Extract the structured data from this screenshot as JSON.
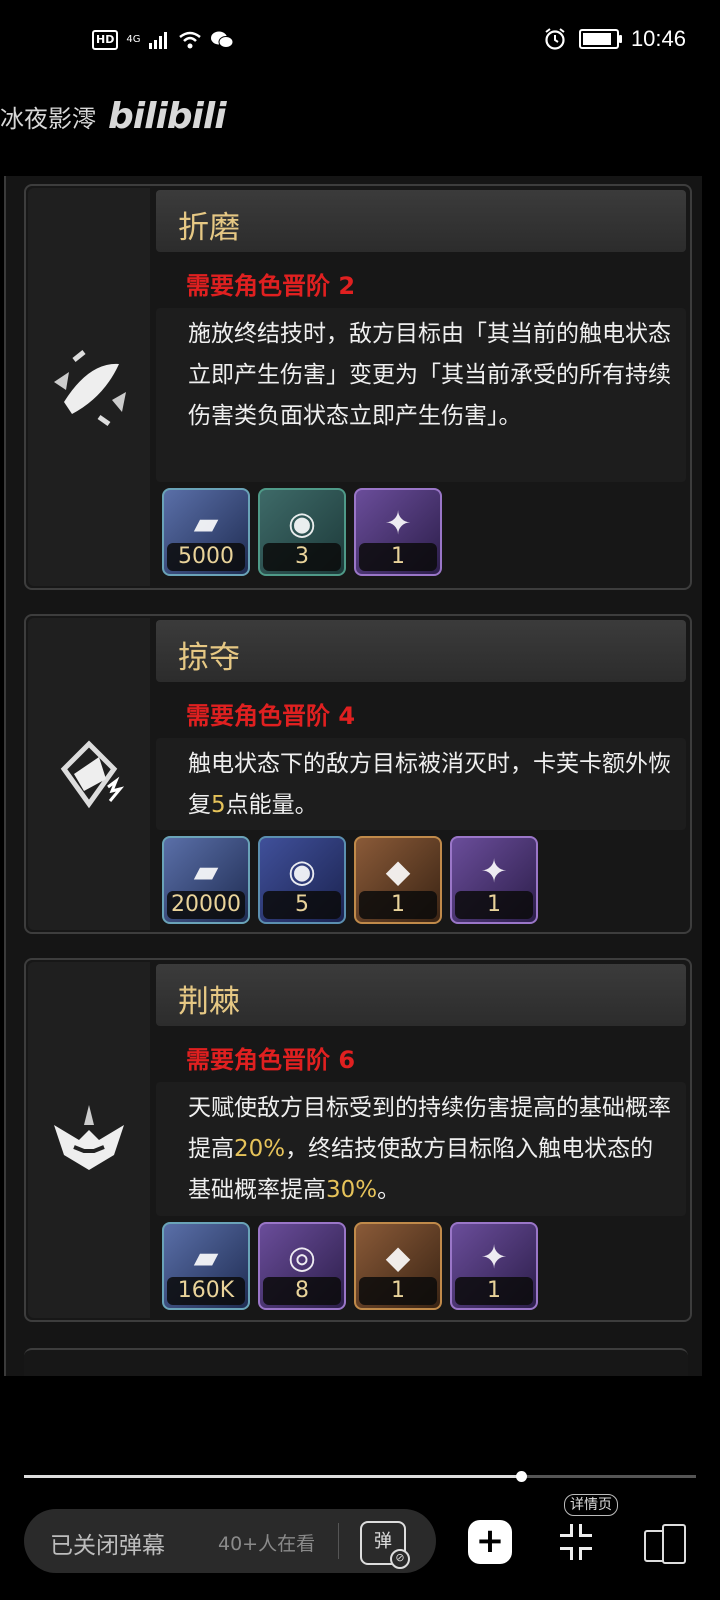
{
  "status_bar": {
    "hd": "HD",
    "network": "4G",
    "time": "10:46",
    "battery_level": 0.92
  },
  "watermark": {
    "channel": "冰夜影澪",
    "logo": "bilibili"
  },
  "cards": [
    {
      "title": "折磨",
      "requirement": "需要角色晋阶 2",
      "description_segments": [
        {
          "text": "施放终结技时，敌方目标由「其当前的触电状态立即产生伤害」变更为「其当前承受的所有持续伤害类负面状态立即产生伤害」。",
          "highlight": false
        }
      ],
      "materials": [
        {
          "count": "5000",
          "icon": "credit-icon",
          "color": "blue"
        },
        {
          "count": "3",
          "icon": "orb-icon",
          "color": "teal"
        },
        {
          "count": "1",
          "icon": "crown-icon",
          "color": "violet"
        }
      ]
    },
    {
      "title": "掠夺",
      "requirement": "需要角色晋阶 4",
      "description_segments": [
        {
          "text": "触电状态下的敌方目标被消灭时，卡芙卡额外恢复",
          "highlight": false
        },
        {
          "text": "5",
          "highlight": true
        },
        {
          "text": "点能量。",
          "highlight": false
        }
      ],
      "materials": [
        {
          "count": "20000",
          "icon": "credit-icon",
          "color": "blue"
        },
        {
          "count": "5",
          "icon": "orb-icon",
          "color": "navy"
        },
        {
          "count": "1",
          "icon": "gem-icon",
          "color": "orange"
        },
        {
          "count": "1",
          "icon": "crown-icon",
          "color": "violet"
        }
      ]
    },
    {
      "title": "荆棘",
      "requirement": "需要角色晋阶 6",
      "description_segments": [
        {
          "text": "天赋使敌方目标受到的持续伤害提高的基础概率提高",
          "highlight": false
        },
        {
          "text": "20%",
          "highlight": true
        },
        {
          "text": "，终结技使敌方目标陷入触电状态的基础概率提高",
          "highlight": false
        },
        {
          "text": "30%",
          "highlight": true
        },
        {
          "text": "。",
          "highlight": false
        }
      ],
      "materials": [
        {
          "count": "160K",
          "icon": "credit-icon",
          "color": "blue"
        },
        {
          "count": "8",
          "icon": "eye-icon",
          "color": "violet"
        },
        {
          "count": "1",
          "icon": "gem-icon",
          "color": "orange"
        },
        {
          "count": "1",
          "icon": "crown-icon",
          "color": "violet"
        }
      ]
    }
  ],
  "player": {
    "progress": 0.74,
    "danmaku_label": "已关闭弹幕",
    "viewers": "40+人在看",
    "danmaku_toggle": "弹",
    "detail_tag": "详情页",
    "add_label": "+"
  }
}
